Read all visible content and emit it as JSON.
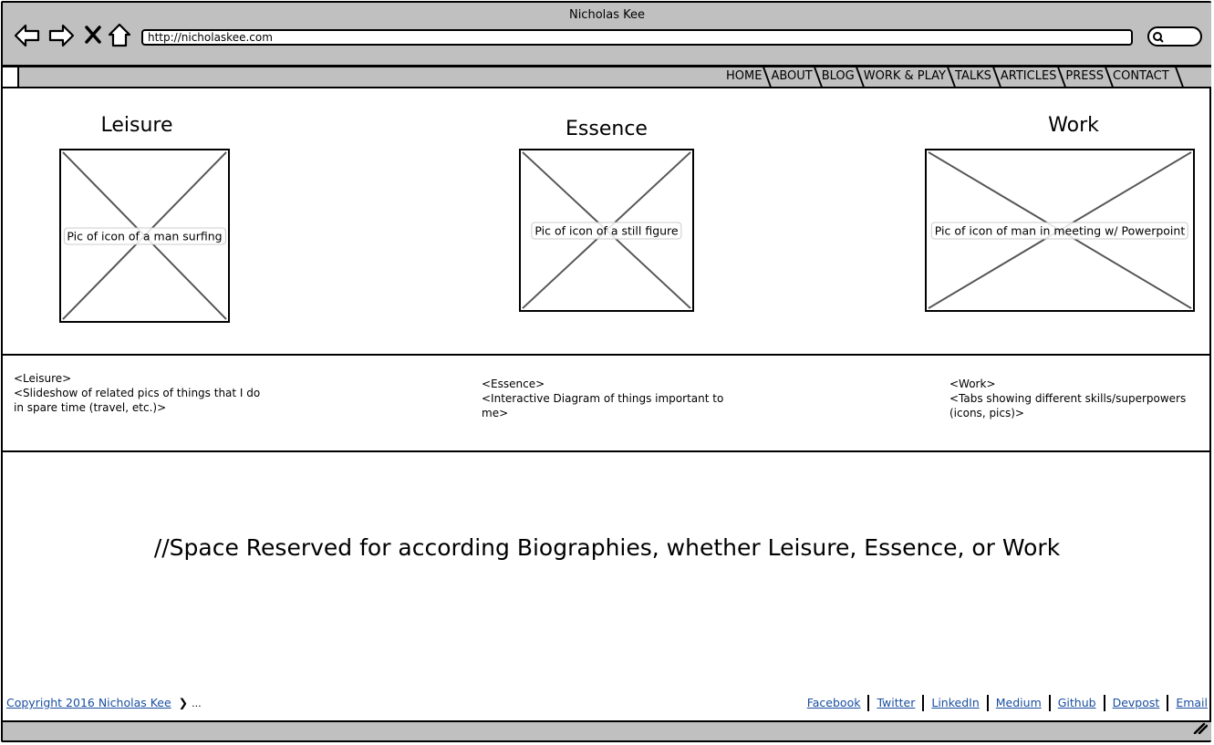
{
  "window": {
    "title": "Nicholas Kee"
  },
  "toolbar": {
    "back_icon": "back-arrow-icon",
    "forward_icon": "forward-arrow-icon",
    "stop_icon": "stop-icon",
    "home_icon": "home-icon",
    "url": "http://nicholaskee.com",
    "search_icon": "search-icon"
  },
  "nav": {
    "tabs": [
      "HOME",
      "ABOUT",
      "BLOG",
      "WORK & PLAY",
      "TALKS",
      "ARTICLES",
      "PRESS",
      "CONTACT"
    ]
  },
  "sections": {
    "leisure": {
      "heading": "Leisure",
      "image_label": "Pic of icon of a man surfing",
      "desc_lines": [
        "<Leisure>",
        "<Slideshow of related pics of things that I do",
        "in spare time (travel, etc.)>"
      ]
    },
    "essence": {
      "heading": "Essence",
      "image_label": "Pic of icon of a still figure",
      "desc_lines": [
        "<Essence>",
        "<Interactive Diagram of things important to",
        "me>"
      ]
    },
    "work": {
      "heading": "Work",
      "image_label": "Pic of icon of man in meeting w/ Powerpoint",
      "desc_lines": [
        "<Work>",
        "<Tabs showing different skills/superpowers",
        "(icons, pics)>"
      ]
    }
  },
  "bio": {
    "text": "//Space Reserved for according Biographies, whether Leisure, Essence, or Work"
  },
  "footer": {
    "copyright": "Copyright 2016 Nicholas Kee",
    "breadcrumb_more": "...",
    "links": [
      "Facebook",
      "Twitter",
      "LinkedIn",
      "Medium",
      "Github",
      "Devpost",
      "Email"
    ]
  },
  "colors": {
    "chrome": "#c0c0c0",
    "link": "#1a4fa0"
  }
}
